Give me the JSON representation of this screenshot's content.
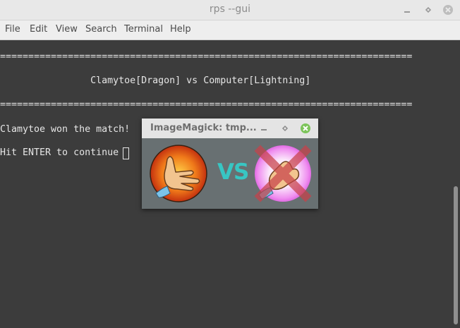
{
  "window": {
    "title": "rps --gui"
  },
  "menu": [
    "File",
    "Edit",
    "View",
    "Search",
    "Terminal",
    "Help"
  ],
  "terminal": {
    "separator": "=========================================================================",
    "matchup": "                Clamytoe[Dragon] vs Computer[Lightning]",
    "result": "Clamytoe won the match!",
    "prompt": "Hit ENTER to continue "
  },
  "popup": {
    "title": "ImageMagick: tmp...",
    "vs_label": "VS",
    "left_gesture": "dragon-hand-icon",
    "right_gesture": "lightning-hand-icon",
    "right_marked": "red-x-icon"
  },
  "colors": {
    "terminal_bg": "#3c3c3c",
    "vs_color": "#38c6c3",
    "close_green": "#7cc45a"
  }
}
